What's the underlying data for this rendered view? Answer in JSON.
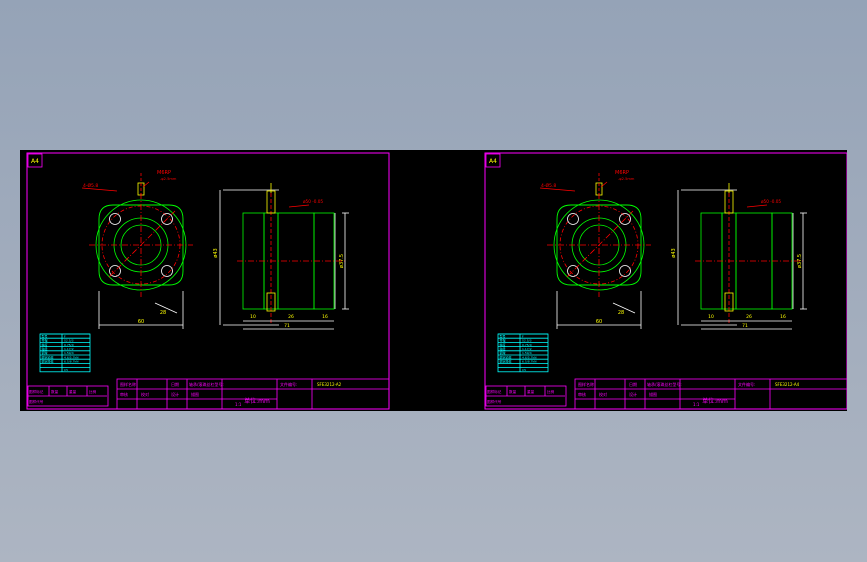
{
  "drawings": [
    {
      "sheet_size": "A4",
      "hole_callout": "4-Ø5.8",
      "screw_label": "M6RP",
      "screw_sub": "-φ2.5mm",
      "fit_label": "ø50 -0.05",
      "dim_bottom_left": "60",
      "dim_diag": "28",
      "dim_left_vertical": "ø43",
      "dim_right_vertical": "ø37.5",
      "dim_small_1": "10",
      "dim_small_2": "26",
      "dim_small_3": "16",
      "dim_total": "71",
      "spec_rows": [
        "型号",
        "导程",
        "精度",
        "轴径",
        "钢球",
        "额定动载",
        "额定静载",
        "",
        ""
      ],
      "spec_values": [
        "F",
        "S2.5/3",
        "0.75/0",
        "1.17/2",
        "1.59/4",
        "4.6/5.7kN",
        "6.5/8.7kN",
        "",
        "C5"
      ],
      "title_block": {
        "r1c1": "图样名称",
        "r1c2": "日期",
        "r1c3": "轴承/滚珠丝杠型号:",
        "r1c4": "文件编号:",
        "drawing_no": "SFE3212-A2",
        "r2c1": "审核",
        "r2c2": "校对",
        "r2c3": "设计",
        "r2c4": "描图",
        "scale_label": "1:1",
        "unit": "单位:mm",
        "left_r1": "图样标记",
        "left_r1b": "数量",
        "left_r1c": "重量",
        "left_r1d": "比例",
        "left_r2": "图样代号"
      }
    },
    {
      "sheet_size": "A4",
      "hole_callout": "4-Ø5.8",
      "screw_label": "M6RP",
      "screw_sub": "-φ2.5mm",
      "fit_label": "ø50 -0.05",
      "dim_bottom_left": "60",
      "dim_diag": "28",
      "dim_left_vertical": "ø43",
      "dim_right_vertical": "ø37.5",
      "dim_small_1": "10",
      "dim_small_2": "26",
      "dim_small_3": "16",
      "dim_total": "71",
      "spec_rows": [
        "型号",
        "导程",
        "精度",
        "轴径",
        "钢球",
        "额定动载",
        "额定静载",
        "",
        ""
      ],
      "spec_values": [
        "F",
        "S2.5/3",
        "0.75/0",
        "1.17/2",
        "1.59/4",
        "4.6/5.7kN",
        "6.5/8.7kN",
        "",
        "C5"
      ],
      "title_block": {
        "r1c1": "图样名称",
        "r1c2": "日期",
        "r1c3": "轴承/滚珠丝杠型号:",
        "r1c4": "文件编号:",
        "drawing_no": "SFE3212-A4",
        "r2c1": "审核",
        "r2c2": "校对",
        "r2c3": "设计",
        "r2c4": "描图",
        "scale_label": "1:1",
        "unit": "单位:mm",
        "left_r1": "图样标记",
        "left_r1b": "数量",
        "left_r1c": "重量",
        "left_r1d": "比例",
        "left_r2": "图样代号"
      }
    }
  ],
  "colors": {
    "frame": "#ff00ff",
    "outline": "#00ff00",
    "center": "#ff0000",
    "dimension": "#00ffff",
    "text": "#ffff00",
    "hatch": "#ffffff"
  }
}
